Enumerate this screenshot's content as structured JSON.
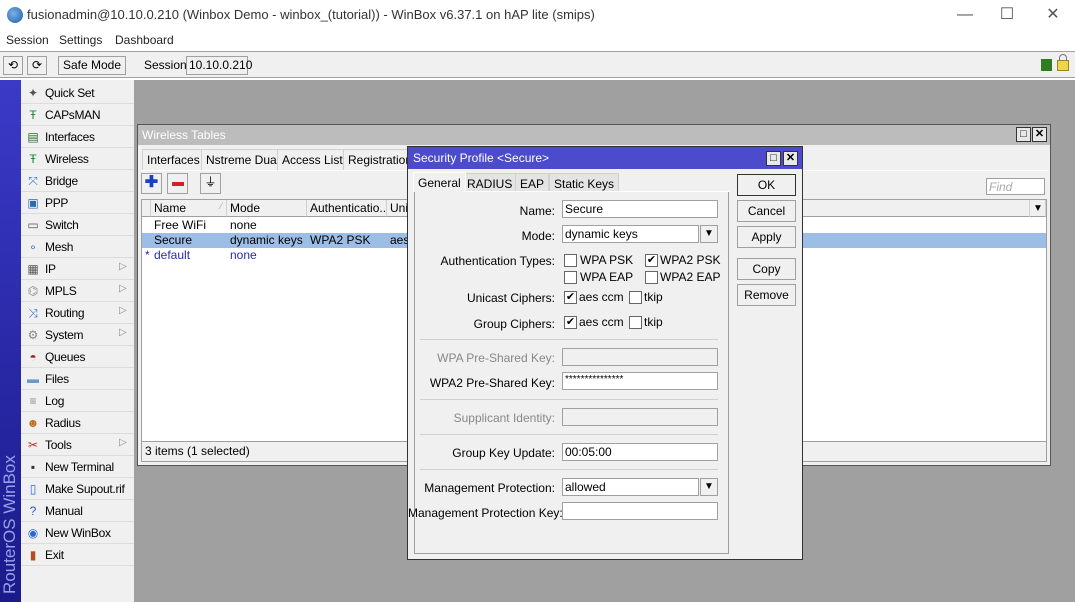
{
  "window": {
    "title": "fusionadmin@10.10.0.210 (Winbox Demo - winbox_(tutorial)) - WinBox v6.37.1 on hAP lite (smips)",
    "minimize": "—",
    "maximize": "☐",
    "close": "✕"
  },
  "menu": [
    "Session",
    "Settings",
    "Dashboard"
  ],
  "toolbar": {
    "undo_icon": "⟲",
    "redo_icon": "⟳",
    "safe_mode": "Safe Mode",
    "session_label": "Session:",
    "session_value": "10.10.0.210",
    "status_color": "#2e7d1e"
  },
  "sidebar": {
    "brand": "RouterOS WinBox",
    "items": [
      {
        "label": "Quick Set",
        "icon": "wand-icon",
        "glyph": "✦",
        "submenu": false
      },
      {
        "label": "CAPsMAN",
        "icon": "antenna-icon",
        "glyph": "Ŧ",
        "submenu": false
      },
      {
        "label": "Interfaces",
        "icon": "network-card-icon",
        "glyph": "▤",
        "submenu": false
      },
      {
        "label": "Wireless",
        "icon": "antenna-icon",
        "glyph": "Ŧ",
        "submenu": false
      },
      {
        "label": "Bridge",
        "icon": "bridge-icon",
        "glyph": "⤧",
        "submenu": false
      },
      {
        "label": "PPP",
        "icon": "ppp-icon",
        "glyph": "▣",
        "submenu": false
      },
      {
        "label": "Switch",
        "icon": "switch-icon",
        "glyph": "▭",
        "submenu": false
      },
      {
        "label": "Mesh",
        "icon": "mesh-icon",
        "glyph": "∘",
        "submenu": false
      },
      {
        "label": "IP",
        "icon": "ip-icon",
        "glyph": "▦",
        "submenu": true
      },
      {
        "label": "MPLS",
        "icon": "mpls-icon",
        "glyph": "⌬",
        "submenu": true
      },
      {
        "label": "Routing",
        "icon": "routing-icon",
        "glyph": "⤨",
        "submenu": true
      },
      {
        "label": "System",
        "icon": "gear-icon",
        "glyph": "⚙",
        "submenu": true
      },
      {
        "label": "Queues",
        "icon": "gauge-icon",
        "glyph": "◓",
        "submenu": false
      },
      {
        "label": "Files",
        "icon": "folder-icon",
        "glyph": "▬",
        "submenu": false
      },
      {
        "label": "Log",
        "icon": "log-icon",
        "glyph": "≡",
        "submenu": false
      },
      {
        "label": "Radius",
        "icon": "users-icon",
        "glyph": "☻",
        "submenu": false
      },
      {
        "label": "Tools",
        "icon": "tools-icon",
        "glyph": "✂",
        "submenu": true
      },
      {
        "label": "New Terminal",
        "icon": "terminal-icon",
        "glyph": "▪",
        "submenu": false
      },
      {
        "label": "Make Supout.rif",
        "icon": "document-icon",
        "glyph": "▯",
        "submenu": false
      },
      {
        "label": "Manual",
        "icon": "help-icon",
        "glyph": "?",
        "submenu": false
      },
      {
        "label": "New WinBox",
        "icon": "winbox-icon",
        "glyph": "◉",
        "submenu": false
      },
      {
        "label": "Exit",
        "icon": "exit-door-icon",
        "glyph": "▮",
        "submenu": false
      }
    ]
  },
  "wireless_tables": {
    "title": "Wireless Tables",
    "tabs": [
      "Interfaces",
      "Nstreme Dual",
      "Access List",
      "Registration"
    ],
    "find_placeholder": "Find",
    "columns": [
      "Name",
      "Mode",
      "Authenticatio...",
      "Unic"
    ],
    "rows": [
      {
        "marker": "",
        "name": "Free WiFi",
        "mode": "none",
        "auth": "",
        "unicast": "",
        "selected": false,
        "default": false
      },
      {
        "marker": "",
        "name": "Secure",
        "mode": "dynamic keys",
        "auth": "WPA2 PSK",
        "unicast": "aes",
        "selected": true,
        "default": false
      },
      {
        "marker": "*",
        "name": "default",
        "mode": "none",
        "auth": "",
        "unicast": "",
        "selected": false,
        "default": true
      }
    ],
    "status": "3 items (1 selected)"
  },
  "security_profile": {
    "title": "Security Profile <Secure>",
    "tabs": [
      "General",
      "RADIUS",
      "EAP",
      "Static Keys"
    ],
    "active_tab": "General",
    "name_label": "Name:",
    "name_value": "Secure",
    "mode_label": "Mode:",
    "mode_value": "dynamic keys",
    "auth_types_label": "Authentication Types:",
    "auth_types": [
      {
        "label": "WPA PSK",
        "checked": false
      },
      {
        "label": "WPA2 PSK",
        "checked": true
      },
      {
        "label": "WPA EAP",
        "checked": false
      },
      {
        "label": "WPA2 EAP",
        "checked": false
      }
    ],
    "unicast_label": "Unicast Ciphers:",
    "unicast": [
      {
        "label": "aes ccm",
        "checked": true
      },
      {
        "label": "tkip",
        "checked": false
      }
    ],
    "group_label": "Group Ciphers:",
    "group": [
      {
        "label": "aes ccm",
        "checked": true
      },
      {
        "label": "tkip",
        "checked": false
      }
    ],
    "wpa_psk_label": "WPA Pre-Shared Key:",
    "wpa_psk_value": "",
    "wpa2_psk_label": "WPA2 Pre-Shared Key:",
    "wpa2_psk_value": "***************",
    "supplicant_label": "Supplicant Identity:",
    "supplicant_value": "",
    "gku_label": "Group Key Update:",
    "gku_value": "00:05:00",
    "mgmt_prot_label": "Management Protection:",
    "mgmt_prot_value": "allowed",
    "mgmt_key_label": "Management Protection Key:",
    "mgmt_key_value": "",
    "buttons": {
      "ok": "OK",
      "cancel": "Cancel",
      "apply": "Apply",
      "copy": "Copy",
      "remove": "Remove"
    },
    "check_glyph": "✔",
    "dropdown_glyph": "▼"
  }
}
